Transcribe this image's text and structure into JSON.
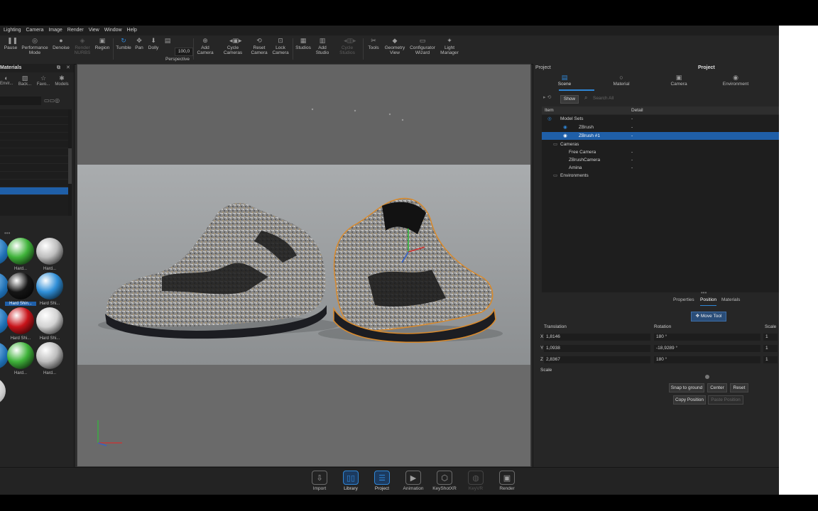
{
  "menubar": {
    "items": [
      "Lighting",
      "Camera",
      "Image",
      "Render",
      "View",
      "Window",
      "Help"
    ]
  },
  "toolbar": {
    "zoom_value": "100,0",
    "buttons": [
      {
        "label": "Pause",
        "icon": "pause-icon"
      },
      {
        "label": "Performance Mode",
        "icon": "performance-icon"
      },
      {
        "label": "Denoise",
        "icon": "denoise-icon"
      },
      {
        "label": "Render NURBS",
        "icon": "nurbs-icon"
      },
      {
        "label": "Region",
        "icon": "region-icon"
      },
      {
        "label": "Tumble",
        "icon": "tumble-icon"
      },
      {
        "label": "Pan",
        "icon": "pan-icon"
      },
      {
        "label": "Dolly",
        "icon": "dolly-icon"
      },
      {
        "label": "Perspective",
        "icon": "perspective-icon"
      },
      {
        "label": "Add Camera",
        "icon": "add-camera-icon"
      },
      {
        "label": "Cycle Cameras",
        "icon": "cycle-cameras-icon"
      },
      {
        "label": "Reset Camera",
        "icon": "reset-camera-icon"
      },
      {
        "label": "Lock Camera",
        "icon": "lock-camera-icon"
      },
      {
        "label": "Studios",
        "icon": "studios-icon"
      },
      {
        "label": "Add Studio",
        "icon": "add-studio-icon"
      },
      {
        "label": "Cycle Studios",
        "icon": "cycle-studios-icon"
      },
      {
        "label": "Tools",
        "icon": "tools-icon"
      },
      {
        "label": "Geometry View",
        "icon": "geometry-view-icon"
      },
      {
        "label": "Configurator Wizard",
        "icon": "configurator-icon"
      },
      {
        "label": "Light Manager",
        "icon": "light-manager-icon"
      }
    ]
  },
  "left_panel": {
    "title": "Materials",
    "tabs": [
      "Envir...",
      "Back...",
      "Favo...",
      "Models"
    ],
    "materials": [
      {
        "label": "Hard...",
        "color": "#3fb33a"
      },
      {
        "label": "Hard...",
        "color": "#bdbdbd"
      },
      {
        "label": "Hard Shin...",
        "color": "#151515"
      },
      {
        "label": "Hard Shi...",
        "color": "#2f8fd8"
      },
      {
        "label": "Hard Shi...",
        "color": "#c8141a"
      },
      {
        "label": "Hard Shi...",
        "color": "#d2d2d2"
      },
      {
        "label": "Hard...",
        "color": "#3fb33a"
      },
      {
        "label": "Hard...",
        "color": "#bdbdbd"
      }
    ]
  },
  "right_panel": {
    "header_left": "Project",
    "header_center": "Project",
    "tabs": [
      "Scene",
      "Material",
      "Camera",
      "Environment"
    ],
    "show_label": "Show",
    "search_placeholder": "Search All",
    "tree_header": {
      "item": "Item",
      "detail": "Detail"
    },
    "tree": [
      {
        "label": "Model Sets",
        "detail": "-"
      },
      {
        "label": "ZBrush",
        "detail": "-"
      },
      {
        "label": "ZBrush #1",
        "detail": "-"
      },
      {
        "label": "Cameras",
        "detail": ""
      },
      {
        "label": "Free Camera",
        "detail": "-"
      },
      {
        "label": "ZBrushCamera",
        "detail": "-"
      },
      {
        "label": "Amina",
        "detail": "-"
      },
      {
        "label": "Environments",
        "detail": ""
      }
    ],
    "subtabs": [
      "Properties",
      "Position",
      "Materials"
    ],
    "move_tool": "Move Tool",
    "transform": {
      "translation_label": "Translation",
      "rotation_label": "Rotation",
      "scale_label": "Scale",
      "x_label": "X",
      "y_label": "Y",
      "z_label": "Z",
      "tx": "1,8146",
      "ty": "1,0938",
      "tz": "2,8367",
      "rx": "180 °",
      "ry": "-18,9289 °",
      "rz": "180 °",
      "sx": "1",
      "sy": "1",
      "sz": "1",
      "scale_row_label": "Scale"
    },
    "buttons": {
      "snap": "Snap to ground",
      "center": "Center",
      "reset": "Reset",
      "copy": "Copy Position",
      "paste": "Paste Position"
    }
  },
  "bottombar": {
    "items": [
      {
        "label": "Import",
        "icon": "import-icon"
      },
      {
        "label": "Library",
        "icon": "library-icon"
      },
      {
        "label": "Project",
        "icon": "project-icon"
      },
      {
        "label": "Animation",
        "icon": "animation-icon"
      },
      {
        "label": "KeyShotXR",
        "icon": "keyshotxr-icon"
      },
      {
        "label": "KeyVR",
        "icon": "keyvr-icon"
      },
      {
        "label": "Render",
        "icon": "render-icon"
      }
    ]
  }
}
